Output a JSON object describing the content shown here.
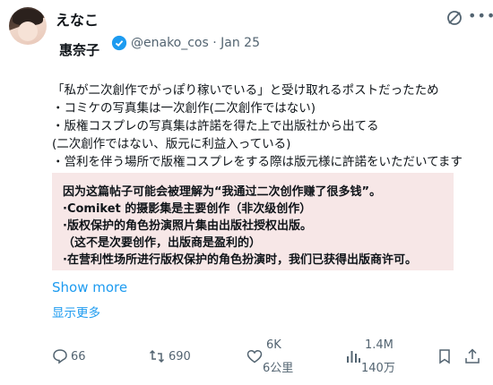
{
  "post": {
    "author_name": "えなこ",
    "quoted": {
      "name": "惠奈子",
      "handle_date": "@enako_cos · Jan 25"
    },
    "japanese_lines": [
      "「私が二次創作でがっぽり稼いでいる」と受け取れるポストだったため",
      "・コミケの写真集は一次創作(二次創作ではない)",
      "・版権コスプレの写真集は許諾を得た上で出版社から出てる",
      "(二次創作ではない、版元に利益入っている)",
      "・営利を伴う場所で版権コスプレをする際は版元様に許諾をいただいてます"
    ],
    "chinese_lines": [
      "因为这篇帖子可能会被理解为“我通过二次创作赚了很多钱”。",
      "·Comiket 的摄影集是主要创作（非次级创作）",
      "·版权保护的角色扮演照片集由出版社授权出版。",
      "（这不是次要创作，出版商是盈利的）",
      "·在营利性场所进行版权保护的角色扮演时，我们已获得出版商许可。"
    ],
    "show_more": "Show more",
    "show_more_cn": "显示更多"
  },
  "actions": {
    "replies": "66",
    "reposts": "690",
    "likes_top": "6K",
    "likes_bottom": "6公里",
    "views_top": "1.4M",
    "views_bottom": "140万"
  },
  "icons": [
    "grok-icon",
    "more-icon",
    "verified-badge-icon",
    "reply-icon",
    "repost-icon",
    "like-icon",
    "views-icon",
    "bookmark-icon",
    "share-icon"
  ],
  "colors": {
    "accent": "#1d9bf0",
    "muted": "#536471",
    "highlight_bg": "#f7e7e7"
  }
}
